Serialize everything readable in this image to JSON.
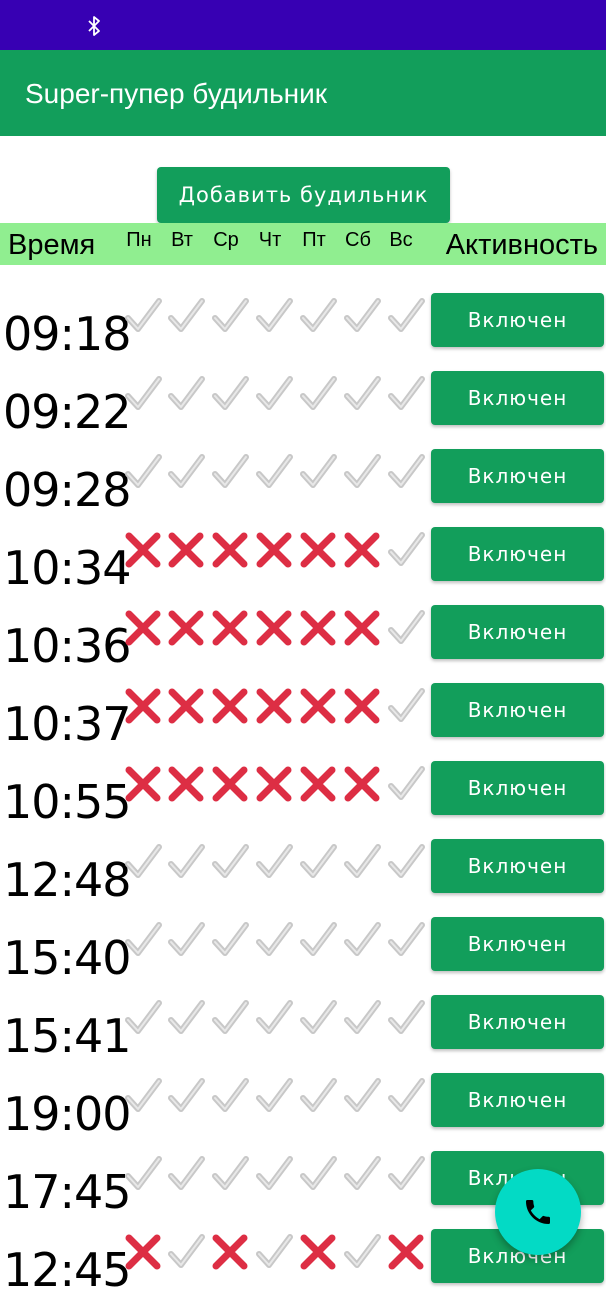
{
  "status_bar": {
    "icons": [
      "bluetooth-icon"
    ],
    "color": "#3700B3"
  },
  "app_bar": {
    "title": "Super-пупер будильник",
    "color": "#129E5B"
  },
  "add_button": {
    "label": "Добавить будильник"
  },
  "header": {
    "time_label": "Время",
    "days": [
      "Пн",
      "Вт",
      "Ср",
      "Чт",
      "Пт",
      "Сб",
      "Вс"
    ],
    "activity_label": "Активность",
    "color": "#90EE90"
  },
  "alarms": [
    {
      "time": "09:18",
      "days": [
        "check",
        "check",
        "check",
        "check",
        "check",
        "check",
        "check"
      ],
      "status": "Включен"
    },
    {
      "time": "09:22",
      "days": [
        "check",
        "check",
        "check",
        "check",
        "check",
        "check",
        "check"
      ],
      "status": "Включен"
    },
    {
      "time": "09:28",
      "days": [
        "check",
        "check",
        "check",
        "check",
        "check",
        "check",
        "check"
      ],
      "status": "Включен"
    },
    {
      "time": "10:34",
      "days": [
        "cross",
        "cross",
        "cross",
        "cross",
        "cross",
        "cross",
        "check"
      ],
      "status": "Включен"
    },
    {
      "time": "10:36",
      "days": [
        "cross",
        "cross",
        "cross",
        "cross",
        "cross",
        "cross",
        "check"
      ],
      "status": "Включен"
    },
    {
      "time": "10:37",
      "days": [
        "cross",
        "cross",
        "cross",
        "cross",
        "cross",
        "cross",
        "check"
      ],
      "status": "Включен"
    },
    {
      "time": "10:55",
      "days": [
        "cross",
        "cross",
        "cross",
        "cross",
        "cross",
        "cross",
        "check"
      ],
      "status": "Включен"
    },
    {
      "time": "12:48",
      "days": [
        "check",
        "check",
        "check",
        "check",
        "check",
        "check",
        "check"
      ],
      "status": "Включен"
    },
    {
      "time": "15:40",
      "days": [
        "check",
        "check",
        "check",
        "check",
        "check",
        "check",
        "check"
      ],
      "status": "Включен"
    },
    {
      "time": "15:41",
      "days": [
        "check",
        "check",
        "check",
        "check",
        "check",
        "check",
        "check"
      ],
      "status": "Включен"
    },
    {
      "time": "19:00",
      "days": [
        "check",
        "check",
        "check",
        "check",
        "check",
        "check",
        "check"
      ],
      "status": "Включен"
    },
    {
      "time": "17:45",
      "days": [
        "check",
        "check",
        "check",
        "check",
        "check",
        "check",
        "check"
      ],
      "status": "Включен"
    },
    {
      "time": "12:45",
      "days": [
        "cross",
        "check",
        "cross",
        "check",
        "cross",
        "check",
        "cross"
      ],
      "status": "Включен"
    }
  ],
  "fab": {
    "icon": "phone-icon",
    "color": "#03DAC5"
  },
  "colors": {
    "check": "#C8C8C8",
    "cross": "#DD2E44",
    "button": "#129E5B"
  }
}
